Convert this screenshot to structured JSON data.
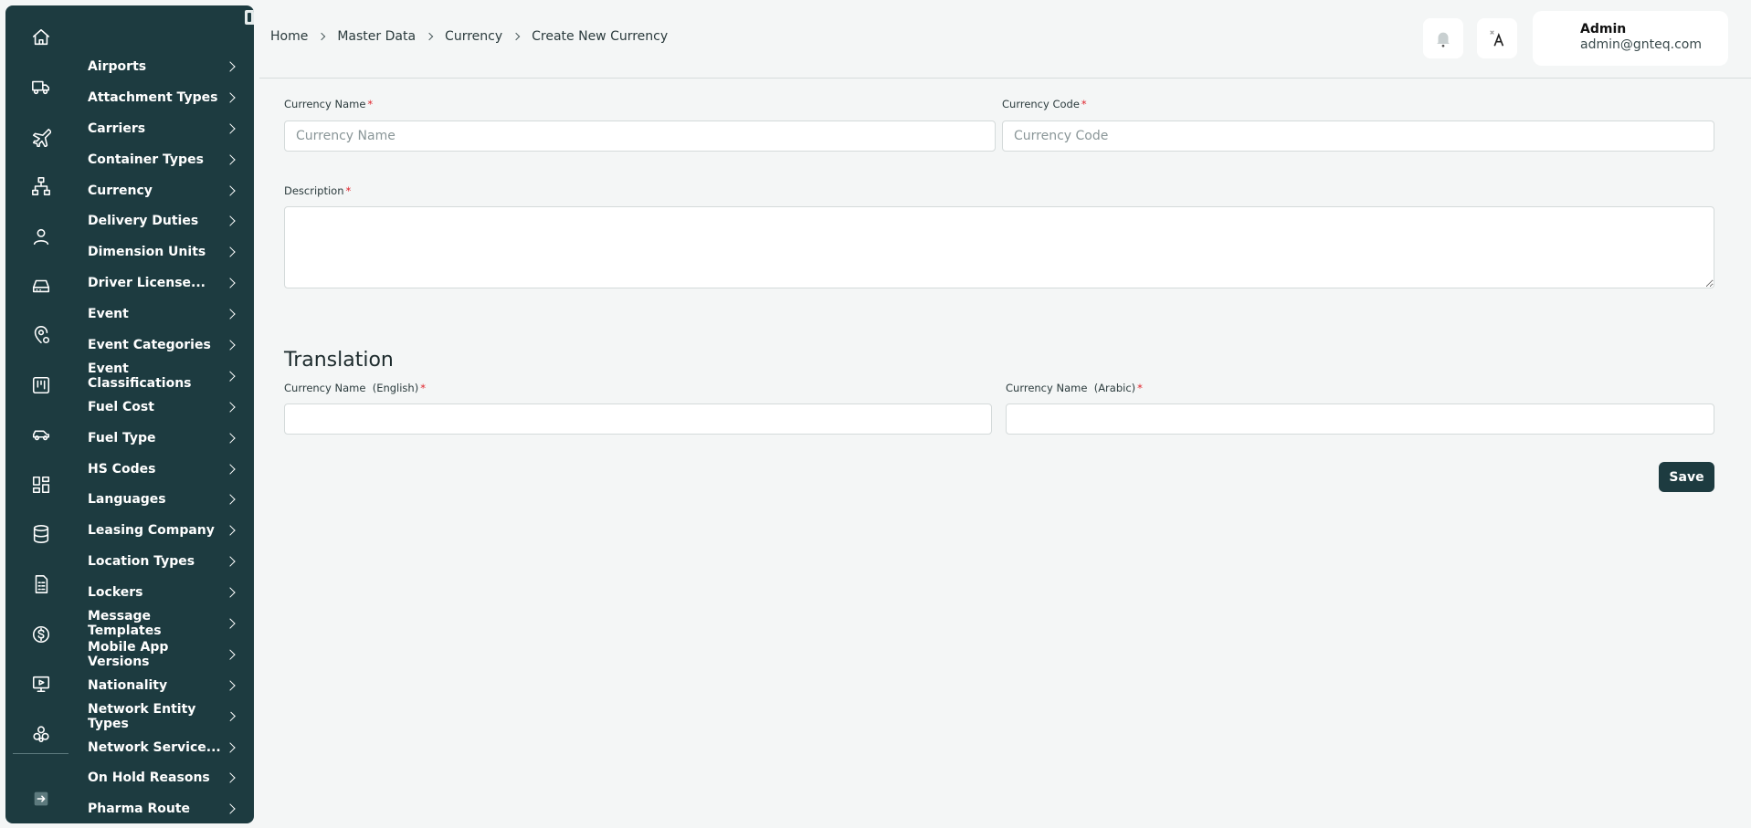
{
  "sidebar": {
    "rail_icons": [
      "home-icon",
      "truck-icon",
      "plane-icon",
      "network-icon",
      "user-icon",
      "drive-icon",
      "location-settings-icon",
      "kanban-icon",
      "car-icon",
      "dashboard-grid-icon",
      "database-icon",
      "report-icon",
      "dollar-icon",
      "monitor-play-icon",
      "cluster-icon",
      "logout-icon"
    ],
    "items": [
      {
        "label": "Airports"
      },
      {
        "label": "Attachment Types"
      },
      {
        "label": "Carriers"
      },
      {
        "label": "Container Types"
      },
      {
        "label": "Currency"
      },
      {
        "label": "Delivery Duties"
      },
      {
        "label": "Dimension Units"
      },
      {
        "label": "Driver License..."
      },
      {
        "label": "Event"
      },
      {
        "label": "Event Categories"
      },
      {
        "label": "Event Classifications"
      },
      {
        "label": "Fuel Cost"
      },
      {
        "label": "Fuel Type"
      },
      {
        "label": "HS Codes"
      },
      {
        "label": "Languages"
      },
      {
        "label": "Leasing Company"
      },
      {
        "label": "Location Types"
      },
      {
        "label": "Lockers"
      },
      {
        "label": "Message Templates"
      },
      {
        "label": "Mobile App Versions"
      },
      {
        "label": "Nationality"
      },
      {
        "label": "Network Entity Types"
      },
      {
        "label": "Network Service..."
      },
      {
        "label": "On Hold Reasons"
      },
      {
        "label": "Pharma Route"
      }
    ]
  },
  "breadcrumb": [
    "Home",
    "Master Data",
    "Currency",
    "Create New Currency"
  ],
  "user": {
    "name": "Admin",
    "email": "admin@gnteq.com"
  },
  "form": {
    "currency_name": {
      "label": "Currency Name",
      "required": "*",
      "placeholder": "Currency Name",
      "value": ""
    },
    "currency_code": {
      "label": "Currency Code",
      "required": "*",
      "placeholder": "Currency Code",
      "value": ""
    },
    "description": {
      "label": "Description",
      "required": "*",
      "value": ""
    },
    "translation_title": "Translation",
    "name_english": {
      "label": "Currency Name  (English)",
      "required": "*",
      "value": ""
    },
    "name_arabic": {
      "label": "Currency Name  (Arabic)",
      "required": "*",
      "value": ""
    },
    "save_label": "Save"
  },
  "colors": {
    "sidebar_bg": "#1d3b40",
    "accent": "#1d3b40",
    "required": "#e0232b"
  }
}
